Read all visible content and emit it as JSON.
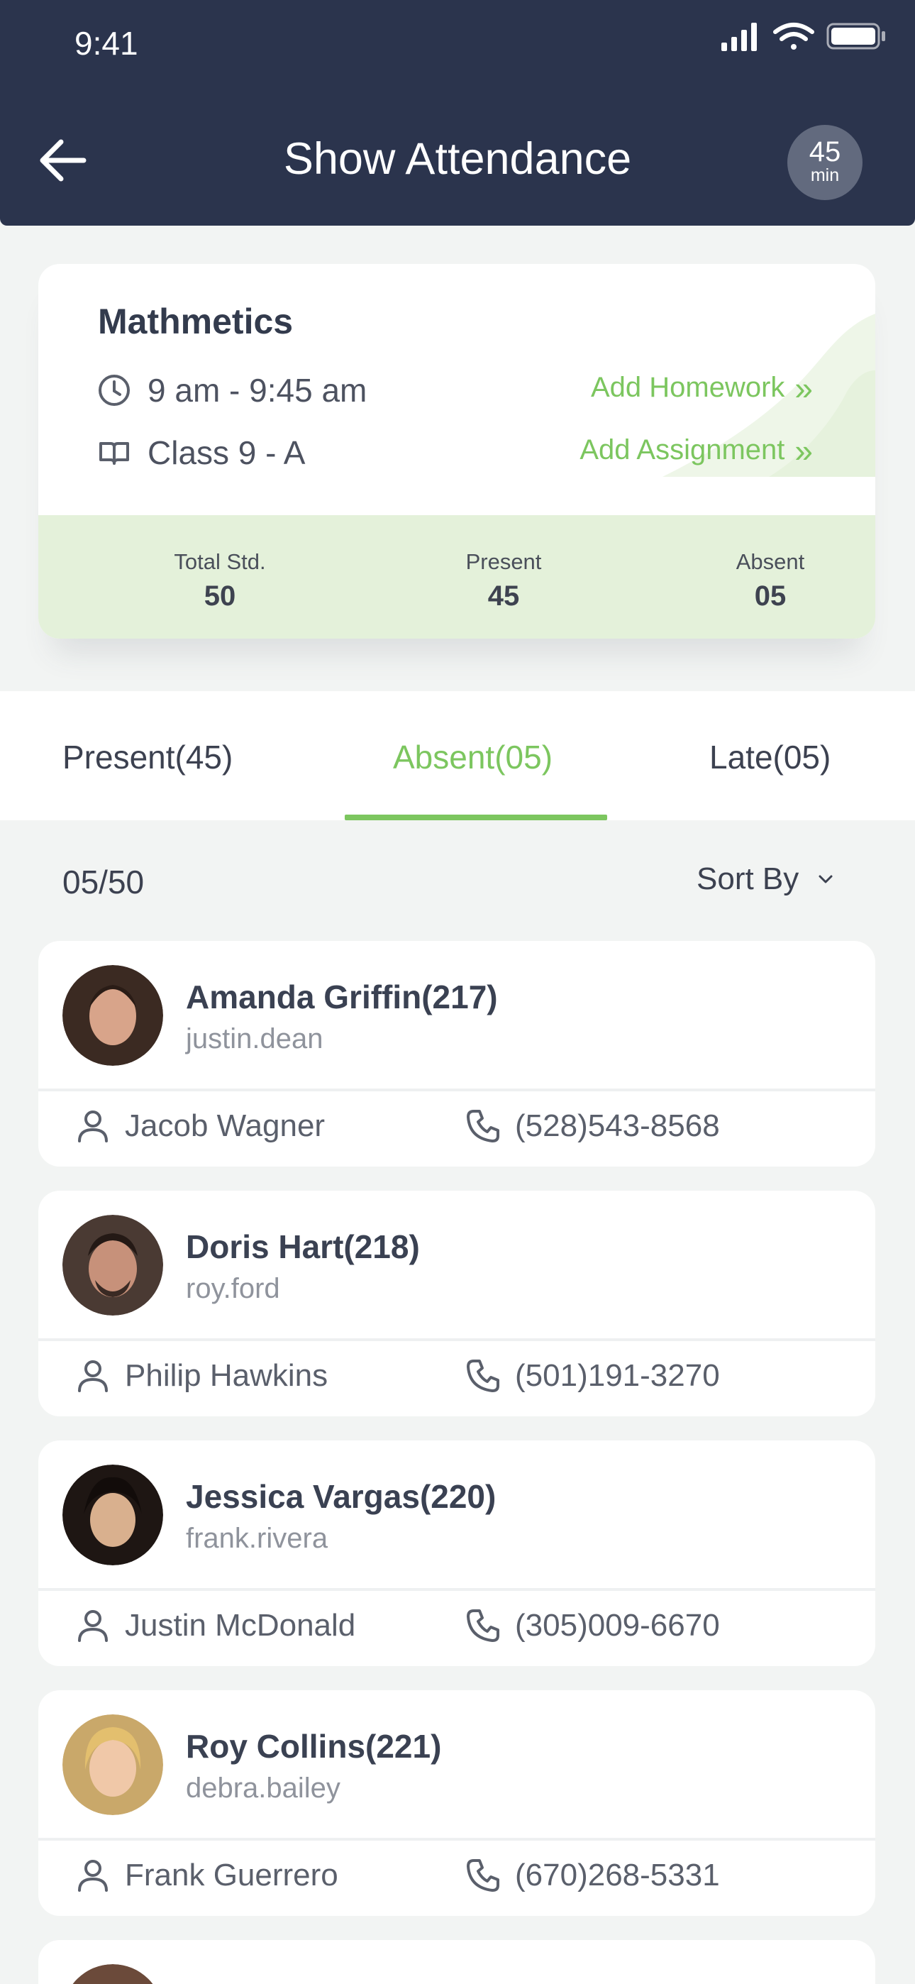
{
  "status_bar": {
    "time": "9:41"
  },
  "header": {
    "title": "Show Attendance",
    "timer_value": "45",
    "timer_unit": "min"
  },
  "class_card": {
    "subject": "Mathmetics",
    "time": "9 am - 9:45 am",
    "class_name": "Class 9 - A",
    "add_homework": "Add Homework",
    "add_assignment": "Add Assignment",
    "stats": [
      {
        "label": "Total Std.",
        "value": "50"
      },
      {
        "label": "Present",
        "value": "45"
      },
      {
        "label": "Absent",
        "value": "05"
      }
    ]
  },
  "tabs": [
    {
      "label": "Present(45)",
      "active": false
    },
    {
      "label": "Absent(05)",
      "active": true
    },
    {
      "label": "Late(05)",
      "active": false
    }
  ],
  "list": {
    "count": "05/50",
    "sort_label": "Sort By"
  },
  "students": [
    {
      "name": "Amanda Griffin(217)",
      "username": "justin.dean",
      "parent": "Jacob Wagner",
      "phone": "(528)543-8568"
    },
    {
      "name": "Doris Hart(218)",
      "username": "roy.ford",
      "parent": "Philip Hawkins",
      "phone": "(501)191-3270"
    },
    {
      "name": "Jessica Vargas(220)",
      "username": "frank.rivera",
      "parent": "Justin McDonald",
      "phone": "(305)009-6670"
    },
    {
      "name": "Roy Collins(221)",
      "username": "debra.bailey",
      "parent": "Frank Guerrero",
      "phone": "(670)268-5331"
    }
  ],
  "colors": {
    "header_bg": "#2b344d",
    "accent_green": "#7cc65f",
    "stats_band": "#e4f1da",
    "page_bg": "#f2f4f3"
  }
}
